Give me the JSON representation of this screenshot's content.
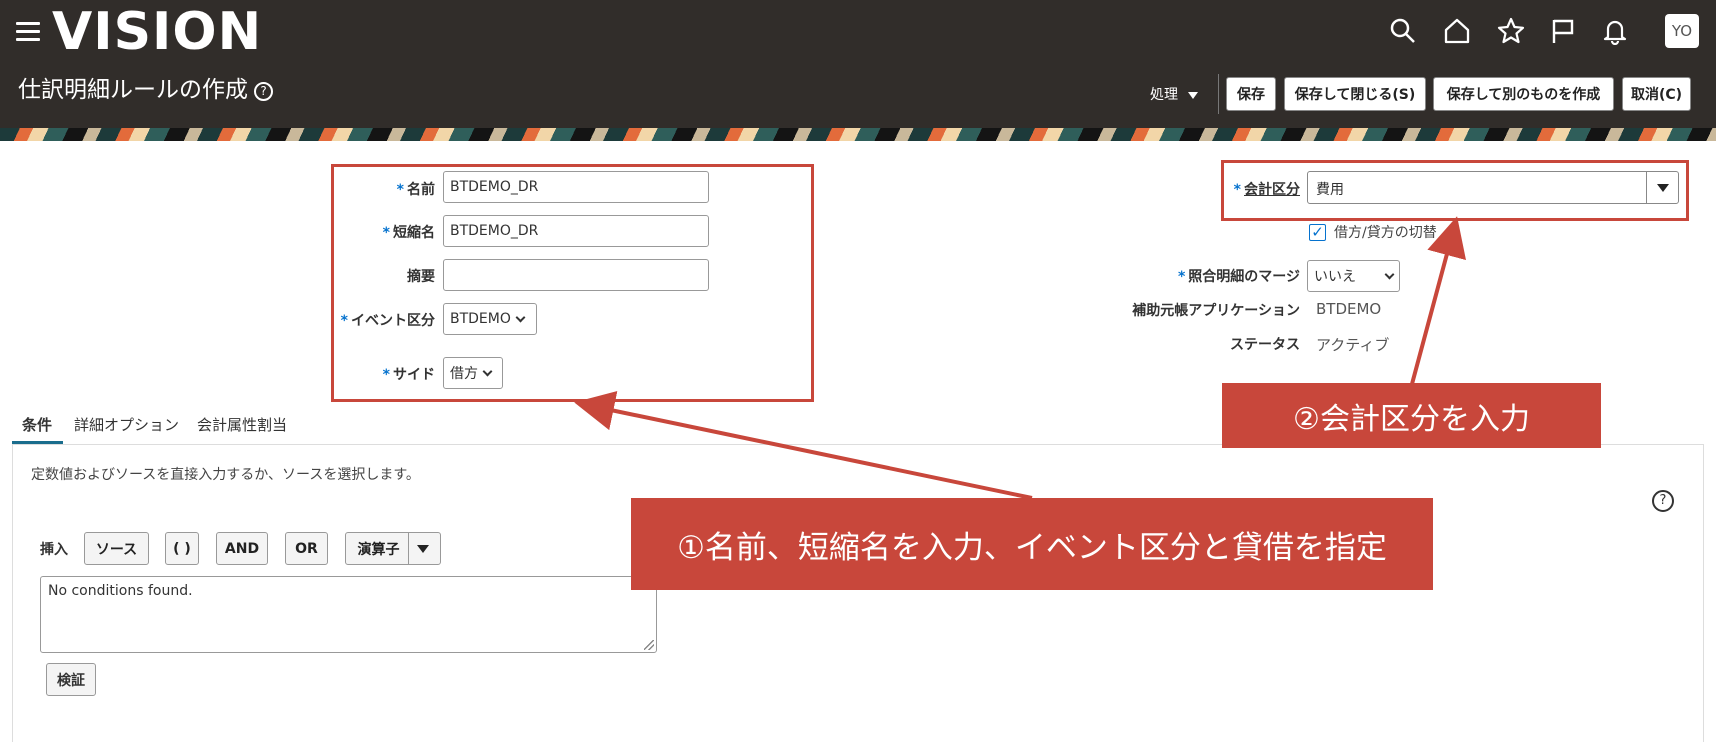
{
  "header": {
    "logo": "VISION",
    "page_title": "仕訳明細ルールの作成",
    "help_glyph": "?",
    "actions_menu": "処理",
    "buttons": {
      "save": "保存",
      "save_close": "保存して閉じる(S)",
      "save_new": "保存して別のものを作成",
      "cancel": "取消(C)"
    },
    "avatar": "YO",
    "icons": [
      "search-icon",
      "home-icon",
      "star-icon",
      "flag-icon",
      "bell-icon"
    ]
  },
  "form_left": {
    "name_label": "名前",
    "name_value": "BTDEMO_DR",
    "short_name_label": "短縮名",
    "short_name_value": "BTDEMO_DR",
    "summary_label": "摘要",
    "summary_value": "",
    "event_class_label": "イベント区分",
    "event_class_value": "BTDEMO",
    "side_label": "サイド",
    "side_value": "借方",
    "required_mark": "*"
  },
  "form_right": {
    "accounting_class_label": "会計区分",
    "accounting_class_value": "費用",
    "switch_dr_cr_label": "借方/貸方の切替",
    "switch_dr_cr_checked": true,
    "merge_label": "照合明細のマージ",
    "merge_value": "いいえ",
    "subledger_label": "補助元帳アプリケーション",
    "subledger_value": "BTDEMO",
    "status_label": "ステータス",
    "status_value": "アクティブ"
  },
  "tabs": [
    {
      "label": "条件",
      "active": true
    },
    {
      "label": "詳細オプション",
      "active": false
    },
    {
      "label": "会計属性割当",
      "active": false
    }
  ],
  "conditions": {
    "description": "定数値およびソースを直接入力するか、ソースを選択します。",
    "insert_label": "挿入",
    "source_btn": "ソース",
    "paren_btn": "( )",
    "and_btn": "AND",
    "or_btn": "OR",
    "operator_btn": "演算子",
    "textarea_value": "No conditions found.",
    "verify_btn": "検証"
  },
  "callouts": {
    "one": "①名前、短縮名を入力、イベント区分と貸借を指定",
    "two": "②会計区分を入力"
  },
  "colors": {
    "header_bg": "#312d2a",
    "annotation_red": "#c8473b",
    "required_blue": "#0572ce"
  }
}
